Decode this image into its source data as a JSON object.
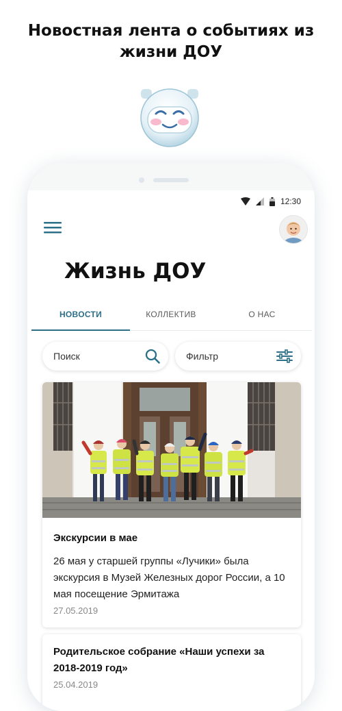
{
  "promo": {
    "headline_line1": "Новостная лента о событиях из",
    "headline_line2": "жизни ДОУ"
  },
  "status_bar": {
    "time": "12:30",
    "icons": [
      "wifi-icon",
      "signal-icon",
      "battery-icon"
    ]
  },
  "header": {
    "menu_icon": "hamburger-icon",
    "avatar": "child-avatar",
    "title": "Жизнь ДОУ"
  },
  "tabs": [
    {
      "label": "НОВОСТИ",
      "active": true
    },
    {
      "label": "КОЛЛЕКТИВ",
      "active": false
    },
    {
      "label": "О НАС",
      "active": false
    }
  ],
  "search": {
    "placeholder": "Поиск",
    "icon": "search-icon"
  },
  "filter": {
    "label": "Фильтр",
    "icon": "sliders-icon"
  },
  "news": [
    {
      "title": "Экскурсии в мае",
      "text": "26 мая у старшей группы «Лучики» была экскурсия в Музей Железных дорог России, а 10 мая посещение Эрмитажа",
      "date": "27.05.2019",
      "image": "children-in-reflective-vests-photo"
    },
    {
      "title": "Родительское собрание «Наши успехи за 2018-2019 год»",
      "date": "25.04.2019"
    }
  ],
  "colors": {
    "accent": "#2b6f88",
    "muted_text": "#888888",
    "phone_frame": "#f6f8f8"
  }
}
